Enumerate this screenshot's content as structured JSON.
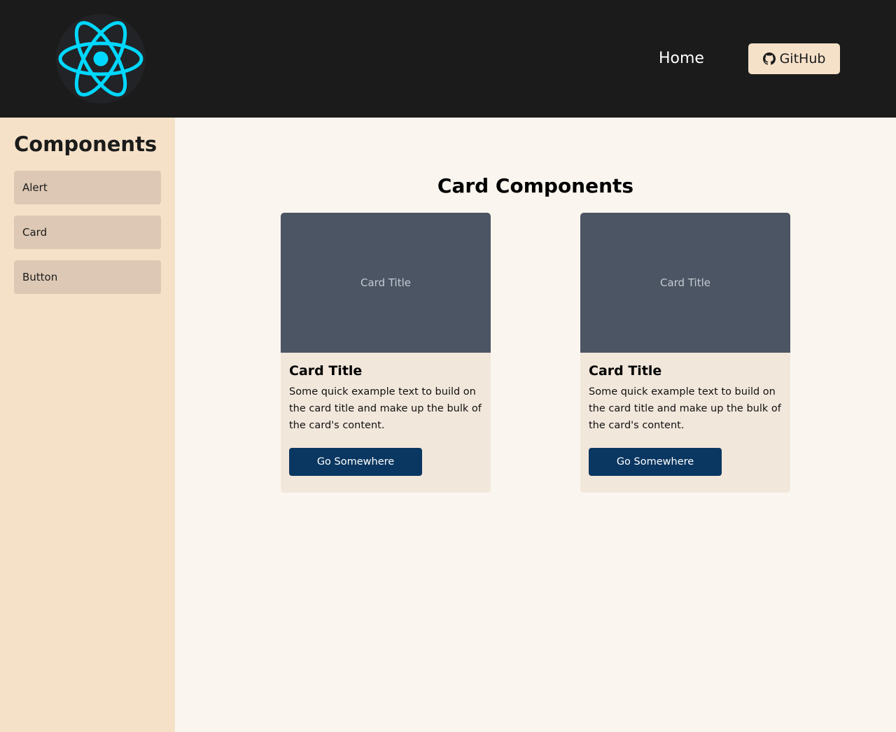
{
  "header": {
    "logo_icon": "react-atom-icon",
    "nav": {
      "home_label": "Home"
    },
    "github_button": {
      "label": "GitHub",
      "icon": "github-icon"
    }
  },
  "sidebar": {
    "title": "Components",
    "items": [
      {
        "label": "Alert"
      },
      {
        "label": "Card"
      },
      {
        "label": "Button"
      }
    ]
  },
  "main": {
    "title": "Card Components",
    "cards": [
      {
        "image_label": "Card Title",
        "title": "Card Title",
        "text": "Some quick example text to build on the card title and make up the bulk of the card's content.",
        "button_label": "Go Somewhere"
      },
      {
        "image_label": "Card Title",
        "title": "Card Title",
        "text": "Some quick example text to build on the card title and make up the bulk of the card's content.",
        "button_label": "Go Somewhere"
      }
    ]
  },
  "colors": {
    "header_bg": "#1b1b1b",
    "sidebar_bg": "#f5e1c8",
    "page_bg": "#faf6ef",
    "react_cyan": "#00d8ff",
    "card_image_bg": "#4b5563",
    "button_primary": "#0a3761"
  }
}
